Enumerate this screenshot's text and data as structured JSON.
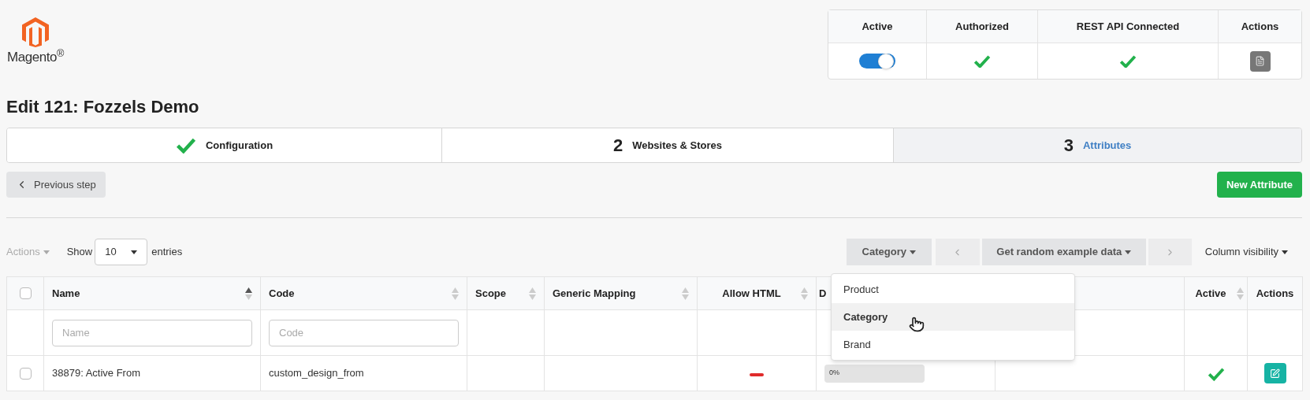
{
  "logo": {
    "text": "Magento$^{®}$"
  },
  "status_table": {
    "columns": [
      "Active",
      "Authorized",
      "REST API Connected",
      "Actions"
    ],
    "active": {
      "on": true
    },
    "authorized": {
      "checked": true
    },
    "rest_api_connected": {
      "checked": true
    }
  },
  "title": "Edit 121: Fozzels Demo",
  "steps": [
    {
      "label": "Configuration",
      "completed": true,
      "selected": false
    },
    {
      "number": "2",
      "label": "Websites & Stores",
      "completed": false,
      "selected": false
    },
    {
      "number": "3",
      "label": "Attributes",
      "completed": false,
      "selected": true
    }
  ],
  "previous_button": "Previous step",
  "new_button": "New Attribute",
  "toolbar": {
    "actions": "Actions",
    "show": "Show",
    "entries_value": "10",
    "entries": "entries",
    "type_button": "Category",
    "random_button": "Get random example data",
    "column_visibility": "Column visibility"
  },
  "type_menu": [
    {
      "label": "Product",
      "selected": false
    },
    {
      "label": "Category",
      "selected": true
    },
    {
      "label": "Brand",
      "selected": false
    }
  ],
  "table": {
    "columns": [
      {
        "kind": "checkbox",
        "checked": false
      },
      {
        "label": "Name",
        "sortable": true,
        "sorted_ascending": true
      },
      {
        "label": "Code",
        "sortable": true,
        "sorted_ascending": false
      },
      {
        "label": "Scope",
        "sortable": true,
        "sorted_ascending": false
      },
      {
        "label": "Generic Mapping",
        "sortable": true,
        "sorted_ascending": false
      },
      {
        "label": "Allow HTML",
        "sortable": true,
        "sorted_ascending": false
      },
      {
        "label": "D"
      },
      {
        "kind": "covered"
      },
      {
        "label": "Active",
        "sortable": true,
        "sorted_ascending": false
      },
      {
        "label": "Actions"
      }
    ],
    "filters": [
      {
        "placeholder": "Name"
      },
      {
        "placeholder": "Code"
      }
    ],
    "rows": [
      {
        "checked": false,
        "name": "38879: Active From",
        "code": "custom_design_from",
        "allow_html": false,
        "progress": {
          "level": 0,
          "reading": "0%"
        },
        "active": true
      }
    ]
  }
}
